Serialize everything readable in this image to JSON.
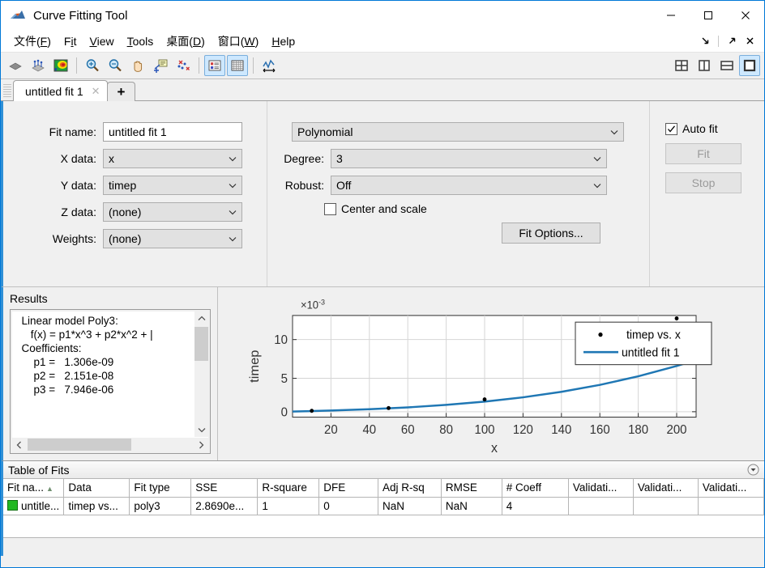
{
  "window": {
    "title": "Curve Fitting Tool",
    "app_icon": "matlab-curvefit-icon",
    "minimize": "—",
    "maximize": "□",
    "close": "✕"
  },
  "menubar": {
    "items": [
      {
        "name": "menu-file",
        "label": "文件(F)",
        "mnemonic": "F"
      },
      {
        "name": "menu-fit",
        "label": "Fit",
        "mnemonic": "i"
      },
      {
        "name": "menu-view",
        "label": "View",
        "mnemonic": "V"
      },
      {
        "name": "menu-tools",
        "label": "Tools",
        "mnemonic": "T"
      },
      {
        "name": "menu-desktop",
        "label": "桌面(D)",
        "mnemonic": "D"
      },
      {
        "name": "menu-window",
        "label": "窗口(W)",
        "mnemonic": "W"
      },
      {
        "name": "menu-help",
        "label": "Help",
        "mnemonic": "H"
      }
    ],
    "right_icons": [
      "dock-arrow-icon",
      "undock-arrow-icon",
      "close-icon"
    ]
  },
  "toolbar": {
    "buttons": [
      {
        "name": "surface-plot-icon",
        "tooltip": "Surface plot"
      },
      {
        "name": "residuals-plot-icon",
        "tooltip": "Residuals plot"
      },
      {
        "name": "contour-plot-icon",
        "tooltip": "Contour plot"
      },
      {
        "name": "zoom-in-icon",
        "tooltip": "Zoom In"
      },
      {
        "name": "zoom-out-icon",
        "tooltip": "Zoom Out"
      },
      {
        "name": "pan-icon",
        "tooltip": "Pan"
      },
      {
        "name": "data-cursor-icon",
        "tooltip": "Data Cursor"
      },
      {
        "name": "exclude-outliers-icon",
        "tooltip": "Exclude outliers"
      },
      {
        "name": "legend-toggle-icon",
        "tooltip": "Legend",
        "active": true
      },
      {
        "name": "grid-toggle-icon",
        "tooltip": "Grid",
        "active": true
      },
      {
        "name": "axes-limits-icon",
        "tooltip": "Axes limits"
      }
    ],
    "layout_buttons": [
      {
        "name": "layout-quad-icon",
        "active": false
      },
      {
        "name": "layout-vertical-split-icon",
        "active": false
      },
      {
        "name": "layout-horizontal-split-icon",
        "active": false
      },
      {
        "name": "layout-single-icon",
        "active": true
      }
    ]
  },
  "tabs": {
    "items": [
      {
        "name": "tab-untitled-fit-1",
        "label": "untitled fit 1",
        "close": "✕",
        "active": true
      }
    ],
    "add_label": "+"
  },
  "fit_config": {
    "fit_name": {
      "label": "Fit name:",
      "value": "untitled fit 1"
    },
    "x_data": {
      "label": "X data:",
      "value": "x"
    },
    "y_data": {
      "label": "Y data:",
      "value": "timep"
    },
    "z_data": {
      "label": "Z data:",
      "value": "(none)"
    },
    "weights": {
      "label": "Weights:",
      "value": "(none)"
    },
    "fit_type": {
      "value": "Polynomial"
    },
    "degree": {
      "label": "Degree:",
      "value": "3"
    },
    "robust": {
      "label": "Robust:",
      "value": "Off"
    },
    "center_and_scale": {
      "label": "Center and scale",
      "checked": false
    },
    "fit_options_label": "Fit Options...",
    "auto_fit": {
      "label": "Auto fit",
      "checked": true
    },
    "fit_button": {
      "label": "Fit",
      "enabled": false
    },
    "stop_button": {
      "label": "Stop",
      "enabled": false
    }
  },
  "results": {
    "title": "Results",
    "text": "  Linear model Poly3:\n     f(x) = p1*x^3 + p2*x^2 + |\n  Coefficients:\n      p1 =   1.306e-09\n      p2 =   2.151e-08\n      p3 =   7.946e-06"
  },
  "chart_data": {
    "type": "line",
    "title": "",
    "xlabel": "x",
    "ylabel": "timep",
    "y_exponent_label": "×10",
    "y_exponent_sup": "-3",
    "xlim": [
      0,
      210
    ],
    "ylim": [
      0,
      0.0131
    ],
    "xticks": [
      20,
      40,
      60,
      80,
      100,
      120,
      140,
      160,
      180,
      200
    ],
    "yticks": [
      0,
      5,
      10
    ],
    "ytick_values": [
      0,
      0.005,
      0.01
    ],
    "grid": true,
    "legend_position": "upper-right-inset",
    "series": [
      {
        "name": "timep vs. x",
        "type": "scatter",
        "marker": "dot",
        "color": "#000000",
        "x": [
          10,
          50,
          100,
          200
        ],
        "y": [
          0.00012,
          0.00055,
          0.00225,
          0.01272
        ]
      },
      {
        "name": "untitled fit 1",
        "type": "line",
        "color": "#1f77b4",
        "equation": "f(x) = 1.306e-09*x^3 + 2.151e-08*x^2 + 7.946e-06*x"
      }
    ]
  },
  "table_of_fits": {
    "title": "Table of Fits",
    "collapse_icon": "chevron-down-circle-icon",
    "columns": [
      {
        "key": "fit_name",
        "label": "Fit na...",
        "sorted": true,
        "sort_dir": "asc"
      },
      {
        "key": "data",
        "label": "Data"
      },
      {
        "key": "fit_type",
        "label": "Fit type"
      },
      {
        "key": "sse",
        "label": "SSE"
      },
      {
        "key": "r_square",
        "label": "R-square"
      },
      {
        "key": "dfe",
        "label": "DFE"
      },
      {
        "key": "adj_r_sq",
        "label": "Adj R-sq"
      },
      {
        "key": "rmse",
        "label": "RMSE"
      },
      {
        "key": "num_coeff",
        "label": "# Coeff"
      },
      {
        "key": "validation1",
        "label": "Validati..."
      },
      {
        "key": "validation2",
        "label": "Validati..."
      },
      {
        "key": "validation3",
        "label": "Validati..."
      }
    ],
    "rows": [
      {
        "swatch_color": "#22b822",
        "fit_name": "untitle...",
        "data": "timep vs...",
        "fit_type": "poly3",
        "sse": "2.8690e...",
        "r_square": "1",
        "dfe": "0",
        "adj_r_sq": "NaN",
        "rmse": "NaN",
        "num_coeff": "4",
        "validation1": "",
        "validation2": "",
        "validation3": ""
      }
    ]
  },
  "colors": {
    "accent_blue": "#2f8fd6",
    "fit_line": "#1f77b4",
    "window_border": "#0078d7",
    "panel_bg": "#f0f0f0"
  }
}
